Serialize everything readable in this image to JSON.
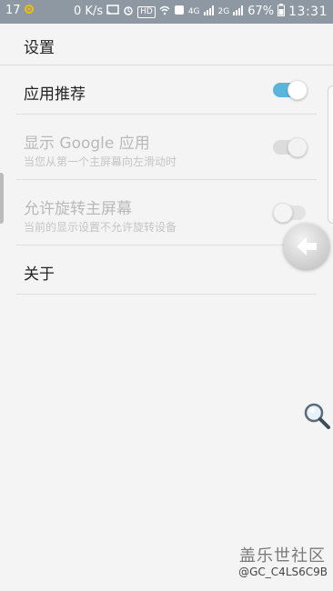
{
  "status_bar": {
    "left_time": "17",
    "speed": "0 K/s",
    "hd": "HD",
    "net": "4G",
    "net2": "2G",
    "battery": "67%",
    "clock": "13:31"
  },
  "header": {
    "title": "设置"
  },
  "settings": [
    {
      "label": "应用推荐",
      "sub": "",
      "state": "on",
      "enabled": true
    },
    {
      "label": "显示 Google 应用",
      "sub": "当您从第一个主屏幕向左滑动时",
      "state": "on",
      "enabled": false
    },
    {
      "label": "允许旋转主屏幕",
      "sub": "当前的显示设置不允许旋转设备",
      "state": "off",
      "enabled": false
    },
    {
      "label": "关于",
      "sub": "",
      "state": null,
      "enabled": true
    }
  ],
  "watermark": {
    "brand": "盖乐世社区",
    "handle": "@GC_C4LS6C9B"
  },
  "colors": {
    "status_bar": "#8e98a3",
    "accent": "#5ab4dc",
    "background": "#f4f4f4"
  }
}
